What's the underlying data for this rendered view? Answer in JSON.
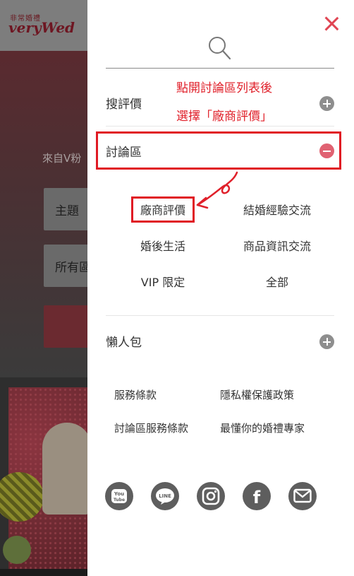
{
  "background": {
    "logo_top": "非常婚禮",
    "logo_main": "veryWed",
    "hero_text": "來自V粉",
    "field1": "主題",
    "field2": "所有區"
  },
  "drawer": {
    "menu": [
      {
        "label": "搜評價",
        "state": "collapsed"
      },
      {
        "label": "討論區",
        "state": "expanded"
      },
      {
        "label": "懶人包",
        "state": "collapsed"
      }
    ],
    "forum_items": [
      "廠商評價",
      "結婚經驗交流",
      "婚後生活",
      "商品資訊交流",
      "VIP 限定",
      "全部"
    ],
    "footer_links": [
      "服務條款",
      "隱私權保護政策",
      "討論區服務條款",
      "最懂你的婚禮專家"
    ],
    "social_icons": [
      "youtube-icon",
      "line-icon",
      "instagram-icon",
      "facebook-icon",
      "mail-icon"
    ],
    "social_labels": {
      "youtube_top": "You",
      "youtube_bottom": "Tube",
      "line": "LINE",
      "facebook": "f"
    }
  },
  "annotation": {
    "line1": "點開討論區列表後",
    "line2": "選擇「廠商評價」"
  },
  "colors": {
    "accent": "#e04553",
    "annotation_red": "#e0202a",
    "minus_pink": "#e06272",
    "plus_gray": "#8e8e8e"
  }
}
